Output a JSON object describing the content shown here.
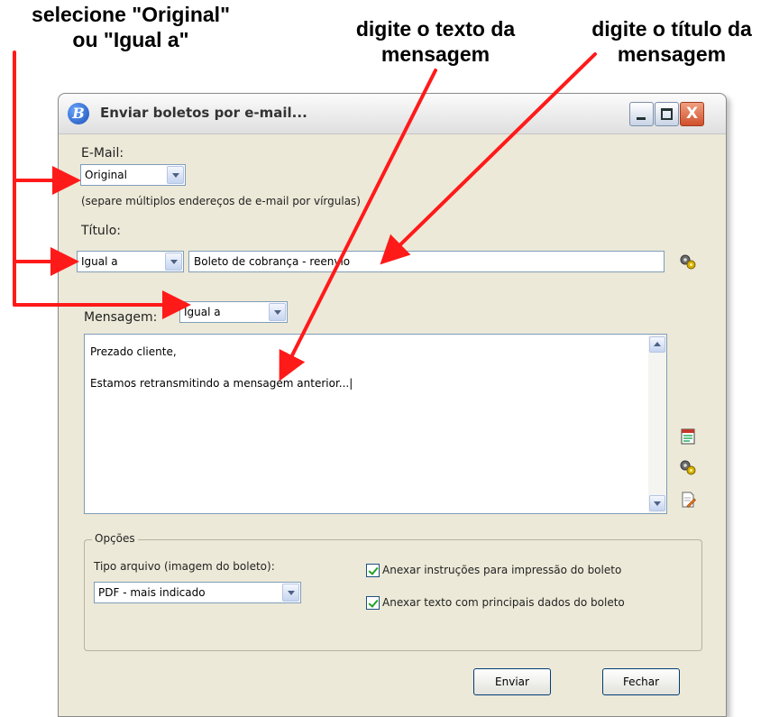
{
  "annotations": {
    "select_hint_line1": "selecione \"Original\"",
    "select_hint_line2": "ou \"Igual a\"",
    "body_hint_line1": "digite o texto da",
    "body_hint_line2": "mensagem",
    "title_hint_line1": "digite o título da",
    "title_hint_line2": "mensagem",
    "arrow_color": "#ff1a1a"
  },
  "window": {
    "title": "Enviar boletos por e-mail...",
    "icon_letter": "B",
    "close_glyph": "X"
  },
  "email": {
    "label": "E-Mail:",
    "select_value": "Original",
    "hint": "(separe múltiplos endereços de e-mail por vírgulas)"
  },
  "titulo": {
    "label": "Título:",
    "select_value": "Igual a",
    "input_value": "Boleto de cobrança - reenvio"
  },
  "mensagem": {
    "label": "Mensagem:",
    "select_value": "Igual a",
    "line1": "Prezado cliente,",
    "line2": "Estamos retransmitindo a mensagem anterior...|"
  },
  "options": {
    "legend": "Opções",
    "file_type_label": "Tipo arquivo (imagem do boleto):",
    "file_type_value": "PDF - mais indicado",
    "check1_label": "Anexar instruções para impressão do boleto",
    "check1_checked": true,
    "check2_label": "Anexar texto com principais dados do boleto",
    "check2_checked": true
  },
  "buttons": {
    "send": "Enviar",
    "close": "Fechar"
  },
  "icons": {
    "title_field_tool": "gears-icon",
    "message_tool_1": "document-icon",
    "message_tool_2": "gears-icon",
    "message_tool_3": "edit-document-icon"
  }
}
